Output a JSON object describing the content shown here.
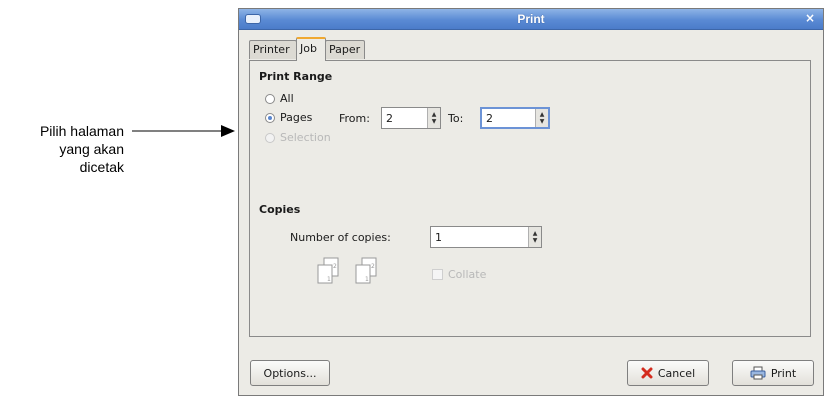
{
  "annotation": {
    "line1": "Pilih halaman",
    "line2": "yang akan",
    "line3": "dicetak"
  },
  "window": {
    "title": "Print",
    "close_glyph": "×"
  },
  "tabs": [
    {
      "label": "Printer",
      "active": false
    },
    {
      "label": "Job",
      "active": true
    },
    {
      "label": "Paper",
      "active": false
    }
  ],
  "print_range": {
    "title": "Print Range",
    "options": {
      "all": {
        "label": "All",
        "checked": false
      },
      "pages": {
        "label": "Pages",
        "checked": true
      },
      "selection": {
        "label": "Selection",
        "enabled": false
      }
    },
    "from_label": "From:",
    "from_value": "2",
    "to_label": "To:",
    "to_value": "2"
  },
  "copies": {
    "title": "Copies",
    "number_label": "Number of copies:",
    "number_value": "1",
    "collate_label": "Collate",
    "collate_checked": false,
    "collate_enabled": false,
    "collate_icon": "collate-pages-icon"
  },
  "footer": {
    "options_label": "Options...",
    "cancel_label": "Cancel",
    "print_label": "Print",
    "cancel_icon": "cancel-x-icon",
    "print_icon": "printer-icon"
  },
  "colors": {
    "titlebar": "#5a8ad4",
    "dialog_bg": "#ecebe6",
    "active_tab_accent": "#f0a830",
    "cancel_x": "#d42c1e"
  }
}
